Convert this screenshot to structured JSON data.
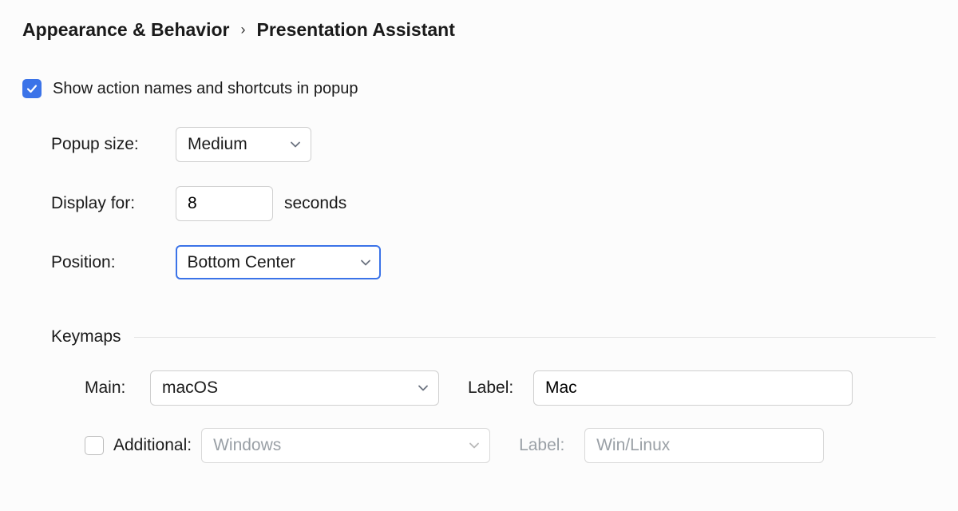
{
  "breadcrumb": {
    "parent": "Appearance & Behavior",
    "separator": "›",
    "current": "Presentation Assistant"
  },
  "popup": {
    "show_in_popup_label": "Show action names and shortcuts in popup",
    "show_in_popup_checked": true,
    "size_label": "Popup size:",
    "size_value": "Medium",
    "display_for_label": "Display for:",
    "display_for_value": "8",
    "display_for_suffix": "seconds",
    "position_label": "Position:",
    "position_value": "Bottom Center"
  },
  "keymaps": {
    "section_title": "Keymaps",
    "main_label": "Main:",
    "main_value": "macOS",
    "main_label2": "Label:",
    "main_label_value": "Mac",
    "additional_label": "Additional:",
    "additional_checked": false,
    "additional_value": "Windows",
    "additional_label2": "Label:",
    "additional_label_value": "Win/Linux"
  }
}
